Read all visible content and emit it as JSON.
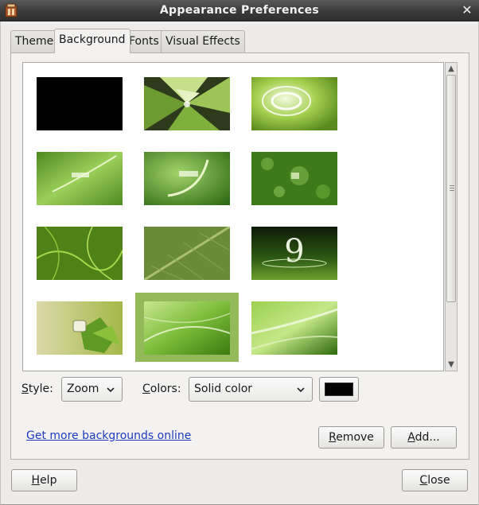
{
  "window": {
    "title": "Appearance Preferences"
  },
  "tabs": [
    {
      "label": "Theme"
    },
    {
      "label": "Background"
    },
    {
      "label": "Fonts"
    },
    {
      "label": "Visual Effects"
    }
  ],
  "wallpapers": [
    {
      "name": "wallpaper-black",
      "selected": false
    },
    {
      "name": "wallpaper-green-geometric-9",
      "selected": false
    },
    {
      "name": "wallpaper-green-swirl",
      "selected": false
    },
    {
      "name": "wallpaper-linux-mint-helena-1",
      "selected": false
    },
    {
      "name": "wallpaper-linux-mint-helena-2",
      "selected": false
    },
    {
      "name": "wallpaper-green-bokeh",
      "selected": false
    },
    {
      "name": "wallpaper-green-texture",
      "selected": false
    },
    {
      "name": "wallpaper-green-leaf",
      "selected": false
    },
    {
      "name": "wallpaper-mint-9-dark",
      "selected": false
    },
    {
      "name": "wallpaper-mint-logo-leaves",
      "selected": false
    },
    {
      "name": "wallpaper-green-rays",
      "selected": true
    },
    {
      "name": "wallpaper-green-light-beams",
      "selected": false
    }
  ],
  "controls": {
    "style_label_mnemonic": "S",
    "style_label_rest": "tyle:",
    "style_value": "Zoom",
    "colors_label_mnemonic": "C",
    "colors_label_rest": "olors:",
    "colors_value": "Solid color",
    "primary_color": "#000000"
  },
  "link": {
    "text": "Get more backgrounds online"
  },
  "buttons": {
    "remove_mnemonic": "R",
    "remove_rest": "emove",
    "add_mnemonic": "A",
    "add_rest": "dd...",
    "help_mnemonic": "H",
    "help_rest": "elp",
    "close_mnemonic": "C",
    "close_rest": "lose"
  },
  "colors": {
    "selection": "#93b95a",
    "link": "#1f3bbf",
    "titlebar": "#3c3c3c"
  }
}
